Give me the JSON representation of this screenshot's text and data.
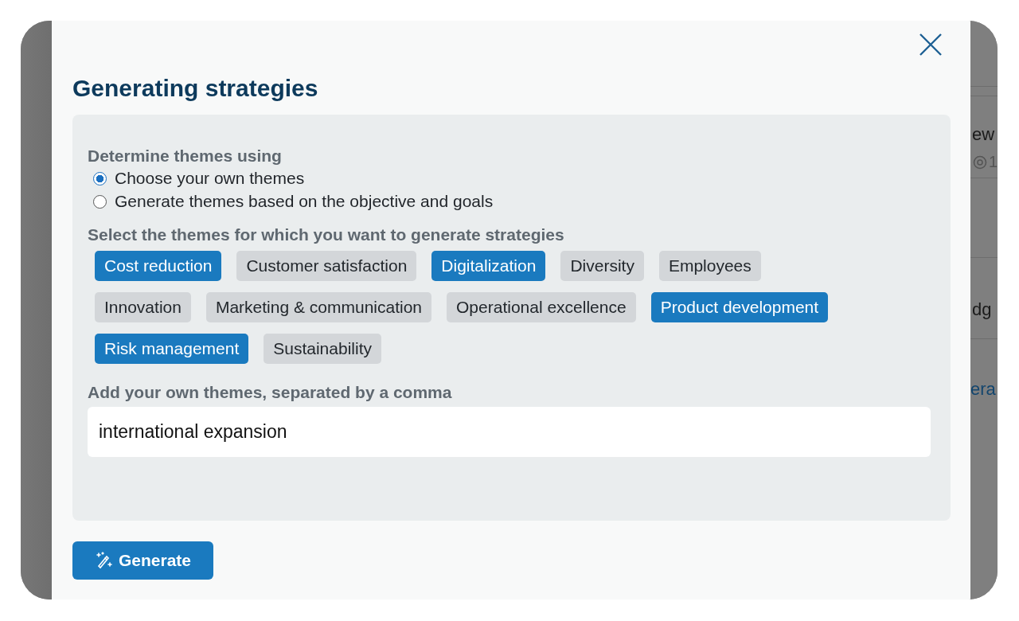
{
  "background": {
    "texts": [
      {
        "text": "ew",
        "kind": "plain"
      },
      {
        "text": "1",
        "kind": "meta"
      },
      {
        "text": "dg",
        "kind": "plain"
      },
      {
        "text": "era",
        "kind": "link"
      }
    ]
  },
  "dialog": {
    "title": "Generating strategies",
    "method": {
      "label": "Determine themes using",
      "options": [
        {
          "label": "Choose your own themes",
          "selected": true
        },
        {
          "label": "Generate themes based on the objective and goals",
          "selected": false
        }
      ]
    },
    "themes": {
      "label": "Select the themes for which you want to generate strategies",
      "items": [
        {
          "label": "Cost reduction",
          "selected": true
        },
        {
          "label": "Customer satisfaction",
          "selected": false
        },
        {
          "label": "Digitalization",
          "selected": true
        },
        {
          "label": "Diversity",
          "selected": false
        },
        {
          "label": "Employees",
          "selected": false
        },
        {
          "label": "Innovation",
          "selected": false
        },
        {
          "label": "Marketing & communication",
          "selected": false
        },
        {
          "label": "Operational excellence",
          "selected": false
        },
        {
          "label": "Product development",
          "selected": true
        },
        {
          "label": "Risk management",
          "selected": true
        },
        {
          "label": "Sustainability",
          "selected": false
        }
      ]
    },
    "own_themes": {
      "label": "Add your own themes, separated by a comma",
      "value": "international expansion"
    },
    "button": "Generate"
  }
}
